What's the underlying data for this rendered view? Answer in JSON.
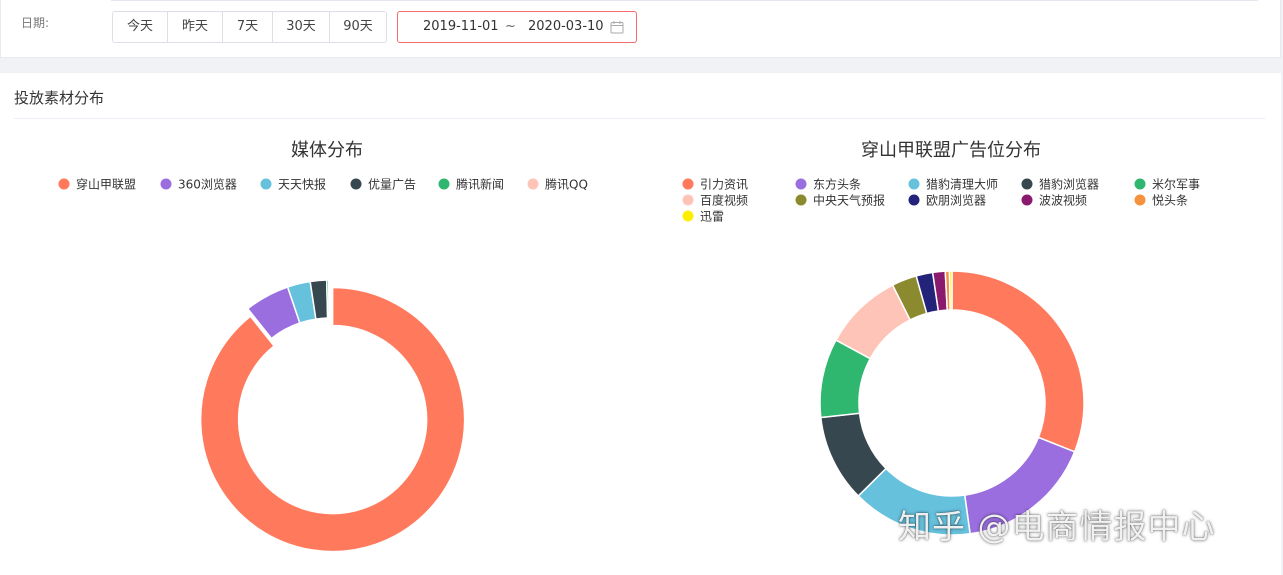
{
  "filter": {
    "date_label": "日期:",
    "quick_ranges": [
      "今天",
      "昨天",
      "7天",
      "30天",
      "90天"
    ],
    "start_date": "2019-11-01",
    "separator": "~",
    "end_date": "2020-03-10",
    "calendar_icon": "calendar-icon"
  },
  "panel": {
    "title": "投放素材分布"
  },
  "watermark": "知乎 @电商情报中心",
  "colors": {
    "palette": [
      "#ff7a5c",
      "#9b6ee0",
      "#66c1dd",
      "#37474f",
      "#2fb66f",
      "#ffc4b8",
      "#8c8a2e",
      "#23237a",
      "#8a1a6e",
      "#f5923e",
      "#ffee00"
    ],
    "accent_error": "#f56c6c"
  },
  "chart_data": [
    {
      "type": "pie",
      "variant": "donut",
      "title": "媒体分布",
      "legend_position": "top-center",
      "categories": [
        "穿山甲联盟",
        "360浏览器",
        "天天快报",
        "优量广告",
        "腾讯新闻",
        "腾讯QQ"
      ],
      "values": [
        89.3,
        5.5,
        2.8,
        2.0,
        0.25,
        0.15
      ],
      "colors": [
        "#ff7a5c",
        "#9b6ee0",
        "#66c1dd",
        "#37474f",
        "#2fb66f",
        "#ffc4b8"
      ],
      "highlighted": "穿山甲联盟"
    },
    {
      "type": "pie",
      "variant": "donut",
      "title": "穿山甲联盟广告位分布",
      "legend_position": "top-center",
      "categories": [
        "引力资讯",
        "东方头条",
        "猎豹清理大师",
        "猎豹浏览器",
        "米尔军事",
        "百度视频",
        "中央天气预报",
        "欧朋浏览器",
        "波波视频",
        "悦头条",
        "迅雷"
      ],
      "values": [
        30.5,
        16.5,
        14.5,
        10.5,
        9.5,
        9.5,
        3.0,
        2.0,
        1.5,
        0.5,
        0.3
      ],
      "colors": [
        "#ff7a5c",
        "#9b6ee0",
        "#66c1dd",
        "#37474f",
        "#2fb66f",
        "#ffc4b8",
        "#8c8a2e",
        "#23237a",
        "#8a1a6e",
        "#f5923e",
        "#ffee00"
      ]
    }
  ]
}
